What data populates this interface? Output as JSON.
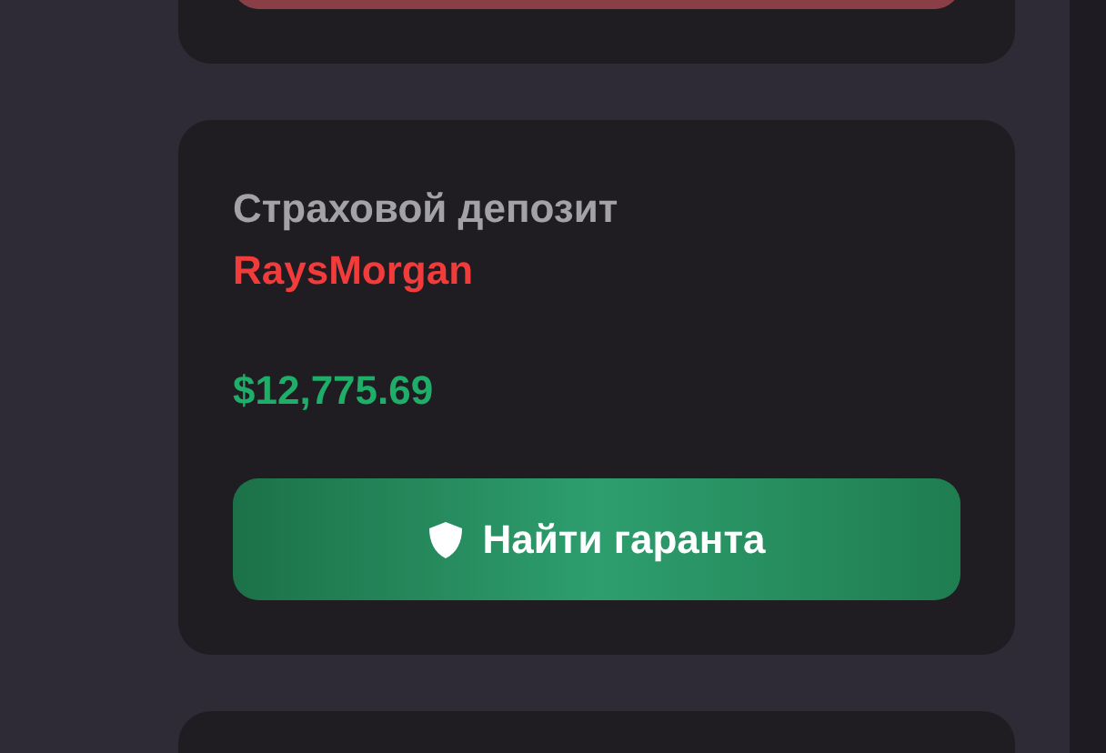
{
  "cards": [
    {
      "kind": "partial"
    },
    {
      "kind": "deposit",
      "title": "Страховой депозит",
      "user": "RaysMorgan",
      "amount": "$12,775.69",
      "button": "Найти гаранта"
    },
    {
      "kind": "partial_bottom"
    }
  ]
}
